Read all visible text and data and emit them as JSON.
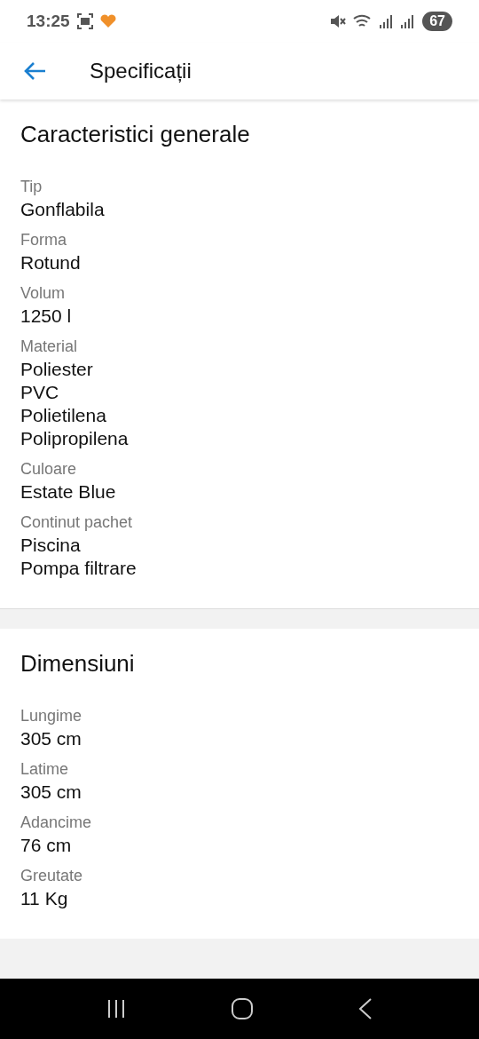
{
  "status_bar": {
    "time": "13:25",
    "battery": "67"
  },
  "header": {
    "title": "Specificații"
  },
  "sections": [
    {
      "title": "Caracteristici generale",
      "specs": [
        {
          "label": "Tip",
          "values": [
            "Gonflabila"
          ]
        },
        {
          "label": "Forma",
          "values": [
            "Rotund"
          ]
        },
        {
          "label": "Volum",
          "values": [
            "1250 l"
          ]
        },
        {
          "label": "Material",
          "values": [
            "Poliester",
            "PVC",
            "Polietilena",
            "Polipropilena"
          ]
        },
        {
          "label": "Culoare",
          "values": [
            "Estate Blue"
          ]
        },
        {
          "label": "Continut pachet",
          "values": [
            "Piscina",
            "Pompa filtrare"
          ]
        }
      ]
    },
    {
      "title": "Dimensiuni",
      "specs": [
        {
          "label": "Lungime",
          "values": [
            "305 cm"
          ]
        },
        {
          "label": "Latime",
          "values": [
            "305 cm"
          ]
        },
        {
          "label": "Adancime",
          "values": [
            "76 cm"
          ]
        },
        {
          "label": "Greutate",
          "values": [
            "11 Kg"
          ]
        }
      ]
    }
  ]
}
